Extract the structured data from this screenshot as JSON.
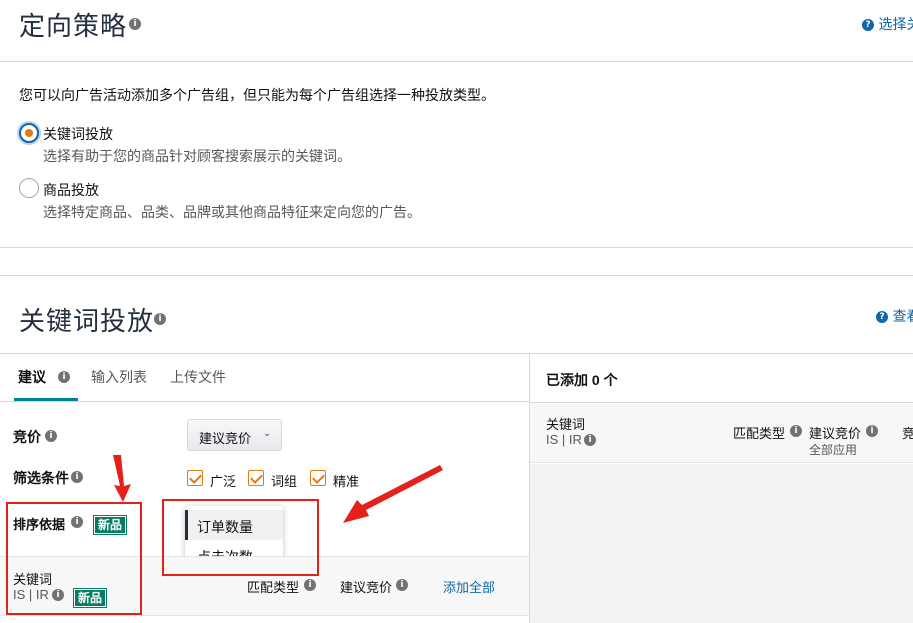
{
  "strategy": {
    "title": "定向策略",
    "help_link": "选择关",
    "intro": "您可以向广告活动添加多个广告组，但只能为每个广告组选择一种投放类型。",
    "options": [
      {
        "label": "关键词投放",
        "desc": "选择有助于您的商品针对顾客搜索展示的关键词。",
        "selected": true
      },
      {
        "label": "商品投放",
        "desc": "选择特定商品、品类、品牌或其他商品特征来定向您的广告。",
        "selected": false
      }
    ]
  },
  "keyword_targeting": {
    "title": "关键词投放",
    "help_link": "查看"
  },
  "tabs": [
    "建议",
    "输入列表",
    "上传文件"
  ],
  "bid": {
    "label": "竞价",
    "button": "建议竞价"
  },
  "filter": {
    "label": "筛选条件",
    "options": [
      "广泛",
      "词组",
      "精准"
    ]
  },
  "sort": {
    "label": "排序依据",
    "badge": "新品",
    "menu": [
      "订单数量",
      "点击次数"
    ]
  },
  "left_table": {
    "keyword_col": "关键词",
    "is_ir": "IS | IR",
    "badge": "新品",
    "match_col": "匹配类型",
    "bid_col": "建议竞价",
    "add_all": "添加全部"
  },
  "right_panel": {
    "added": "已添加 0 个",
    "keyword_col": "关键词",
    "is_ir": "IS | IR",
    "match_col": "匹配类型",
    "bid_col": "建议竞价",
    "apply_all": "全部应用",
    "cut_col": "竞"
  },
  "colors": {
    "accent": "#e47911",
    "link": "#1066a8",
    "badge": "#067d62",
    "annotation": "#e3211a"
  }
}
